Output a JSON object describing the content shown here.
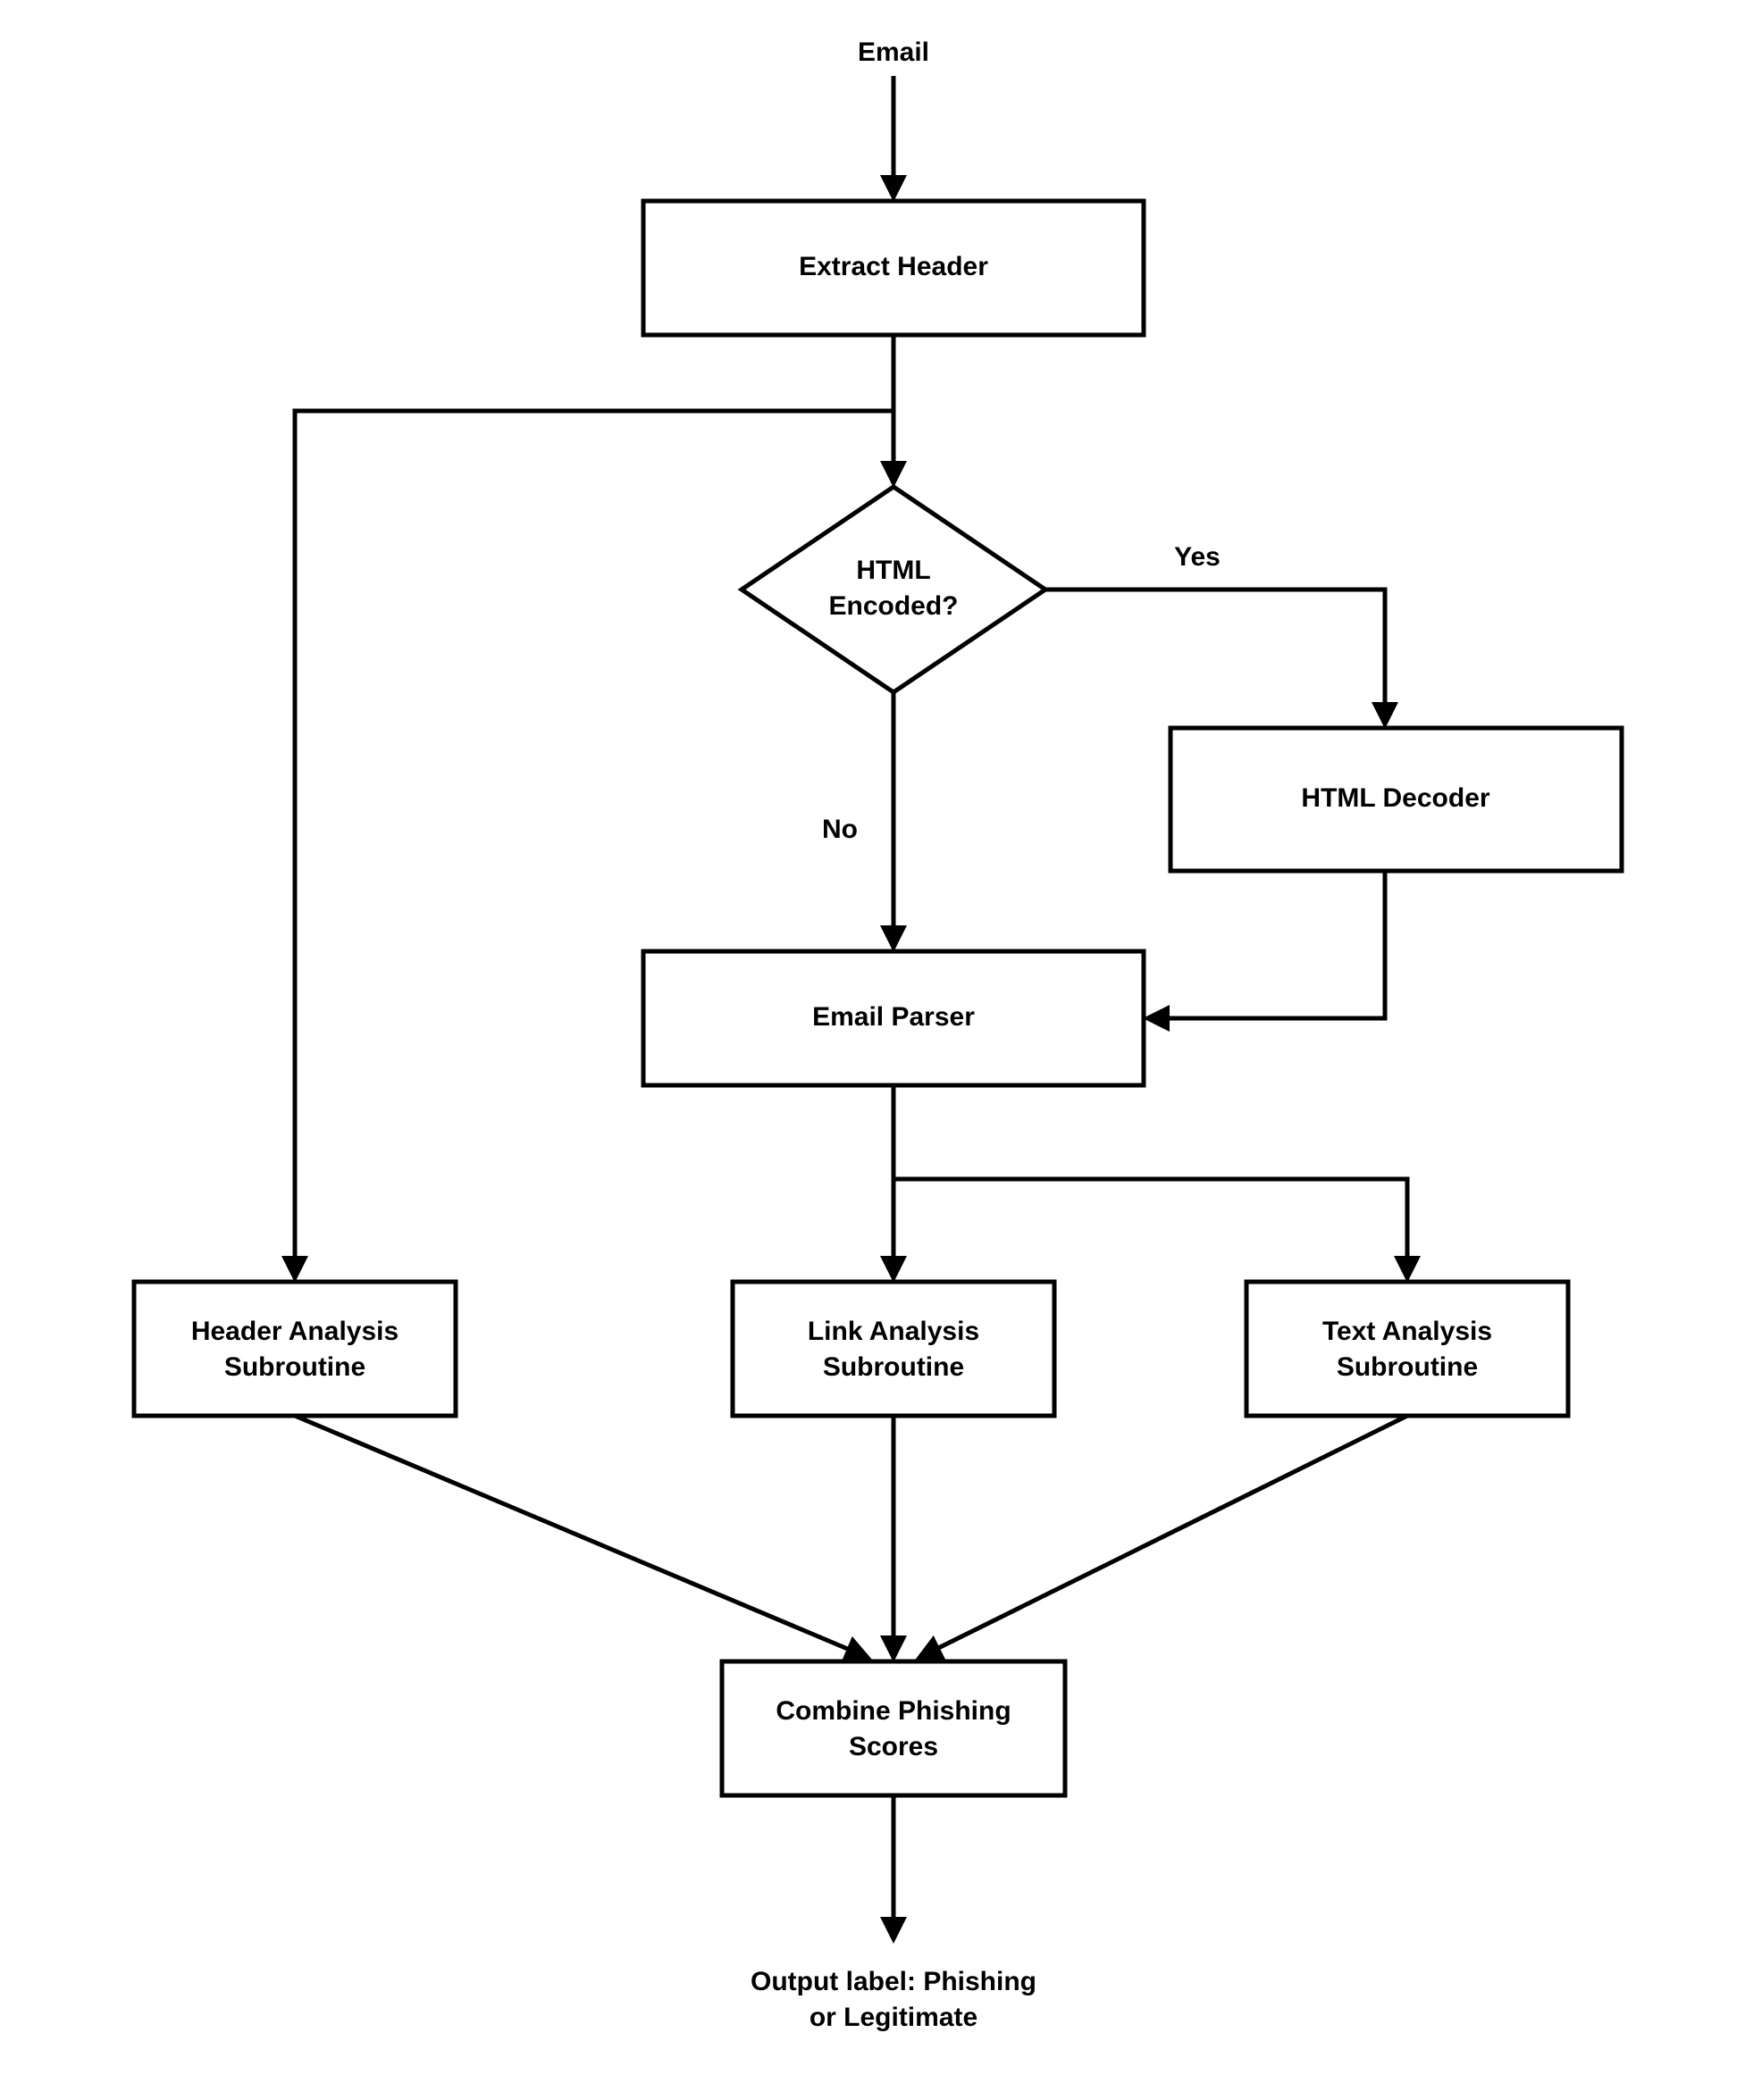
{
  "nodes": {
    "start": "Email",
    "extract_header": "Extract Header",
    "decision": {
      "line1": "HTML",
      "line2": "Encoded?"
    },
    "html_decoder": "HTML Decoder",
    "email_parser": "Email Parser",
    "header_sub": {
      "line1": "Header Analysis",
      "line2": "Subroutine"
    },
    "link_sub": {
      "line1": "Link Analysis",
      "line2": "Subroutine"
    },
    "text_sub": {
      "line1": "Text Analysis",
      "line2": "Subroutine"
    },
    "combine": {
      "line1": "Combine Phishing",
      "line2": "Scores"
    },
    "output": {
      "line1": "Output label: Phishing",
      "line2": "or Legitimate"
    }
  },
  "edges": {
    "yes": "Yes",
    "no": "No"
  }
}
